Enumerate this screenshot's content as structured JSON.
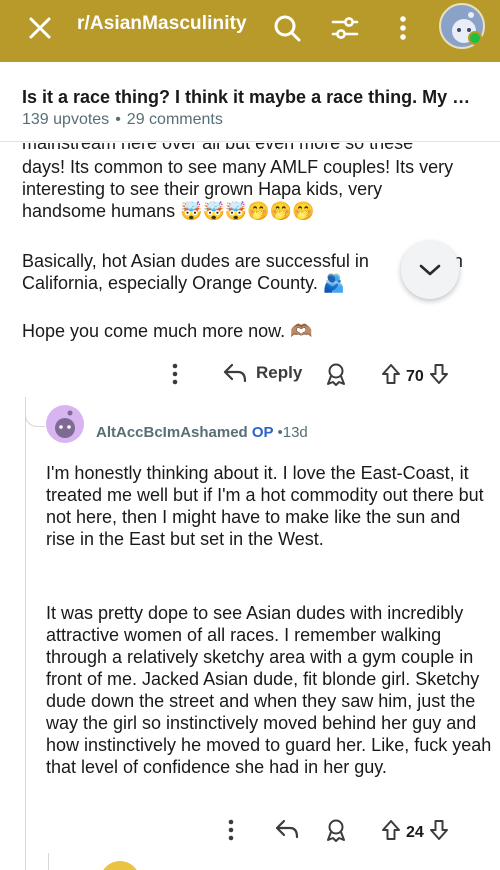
{
  "topbar": {
    "subreddit": "r/AsianMasculinity",
    "background": "#b89a2a",
    "icons": [
      "close-icon",
      "search-icon",
      "filter-icon",
      "more-vertical-icon",
      "avatar"
    ]
  },
  "post": {
    "title": "Is it a race thing? I think it maybe a race thing. My …",
    "upvotes": "139 upvotes",
    "separator": "•",
    "comments": "29 comments"
  },
  "parent_comment": {
    "partial_top_line": "mainstream here over all but even more so these",
    "paragraph1": "days! Its common to see many AMLF couples! Its very interesting to see their grown Hapa kids, very handsome humans 🤯🤯🤯🤭🤭🤭",
    "paragraph2": "Basically, hot Asian dudes are successful in            ut in California, especially Orange County. 🫂",
    "paragraph3": "Hope you come much more now. 🫶🏽",
    "actions": {
      "reply_label": "Reply",
      "score": "70"
    }
  },
  "reply_comment": {
    "username": "AltAccBcImAshamed",
    "op_badge": "OP",
    "separator": "•",
    "time": "13d",
    "paragraph1": "I'm honestly thinking about it. I love the East-Coast, it treated me well but if I'm a hot commodity out there but not here, then I might have to make like the sun and rise in the East but set in the West.",
    "paragraph2": "It was pretty dope to see Asian dudes with incredibly attractive women of all races. I remember walking through a relatively sketchy area with a gym couple in front of me. Jacked Asian dude, fit blonde girl. Sketchy dude down the street and when they saw him, just the way the girl so instinctively moved behind her guy and how instinctively he moved to guard her. Like, fuck yeah that level of confidence she had in her guy.",
    "actions": {
      "score": "24"
    }
  },
  "colors": {
    "accent": "#b89a2a",
    "op_blue": "#2e62c6",
    "meta_gray": "#576f76"
  }
}
